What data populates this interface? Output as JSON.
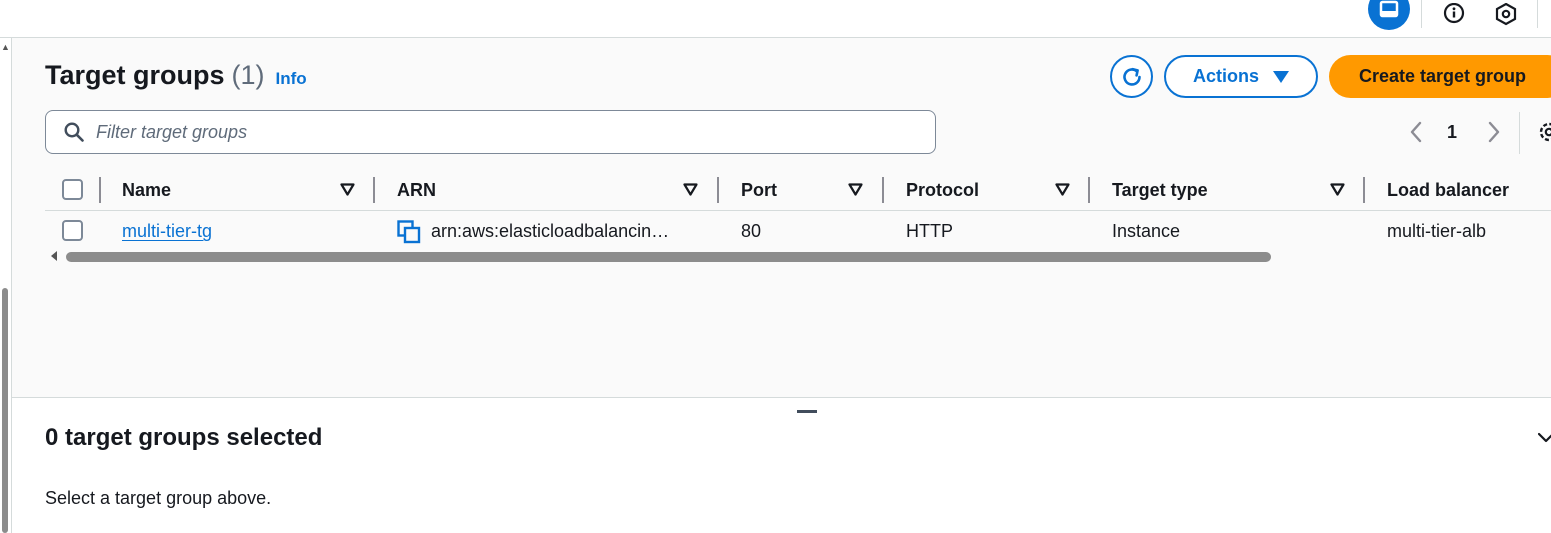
{
  "header": {
    "title": "Target groups",
    "count": "(1)",
    "info_label": "Info"
  },
  "toolbar": {
    "actions_label": "Actions",
    "create_label": "Create target group"
  },
  "filter": {
    "placeholder": "Filter target groups",
    "value": ""
  },
  "pagination": {
    "current_page": "1"
  },
  "table": {
    "columns": [
      "Name",
      "ARN",
      "Port",
      "Protocol",
      "Target type",
      "Load balancer"
    ],
    "rows": [
      {
        "name": "multi-tier-tg",
        "arn": "arn:aws:elasticloadbalancin…",
        "port": "80",
        "protocol": "HTTP",
        "target_type": "Instance",
        "load_balancer": "multi-tier-alb"
      }
    ]
  },
  "split_panel": {
    "title": "0 target groups selected",
    "body": "Select a target group above."
  },
  "icons": {
    "top": [
      "panel-icon",
      "info-icon",
      "hexagon-settings-icon"
    ],
    "toolbar": [
      "refresh-icon",
      "caret-down-icon"
    ],
    "filter": "search-icon",
    "pagination": [
      "chevron-left-icon",
      "chevron-right-icon",
      "gear-icon"
    ],
    "arn": "copy-icon"
  },
  "colors": {
    "accent": "#0972d3",
    "primary_button": "#ff9900",
    "text": "#16191f",
    "muted": "#5f6b7a"
  }
}
